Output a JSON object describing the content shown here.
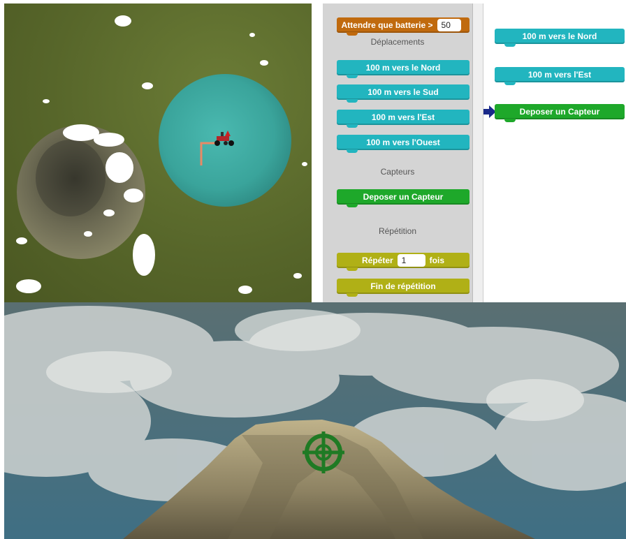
{
  "palette": {
    "battery_block": {
      "label": "Attendre que batterie >",
      "value": "50"
    },
    "categories": {
      "movement": "Déplacements",
      "sensors": "Capteurs",
      "repeat": "Répétition"
    },
    "move_blocks": [
      "100 m vers le Nord",
      "100 m vers le Sud",
      "100 m vers l'Est",
      "100 m vers l'Ouest"
    ],
    "sensor_block": "Deposer un Capteur",
    "repeat_block": {
      "label_before": "Répéter",
      "value": "1",
      "label_after": "fois"
    },
    "end_repeat_block": "Fin de répétition"
  },
  "workspace": {
    "blocks": [
      "100 m vers le Nord",
      "100 m vers l'Est",
      "Deposer un Capteur"
    ]
  },
  "colors": {
    "move": "#22b5bf",
    "sensor": "#1ea82a",
    "repeat": "#b0b016",
    "battery": "#c06a0e",
    "lake": "#3ea79f",
    "terrain": "#57662a",
    "target": "#1f7a24"
  },
  "icons": {
    "rover": "rover-icon",
    "path": "path-trace",
    "crosshair": "crosshair-target-icon",
    "pointer": "workspace-arrow-icon"
  }
}
